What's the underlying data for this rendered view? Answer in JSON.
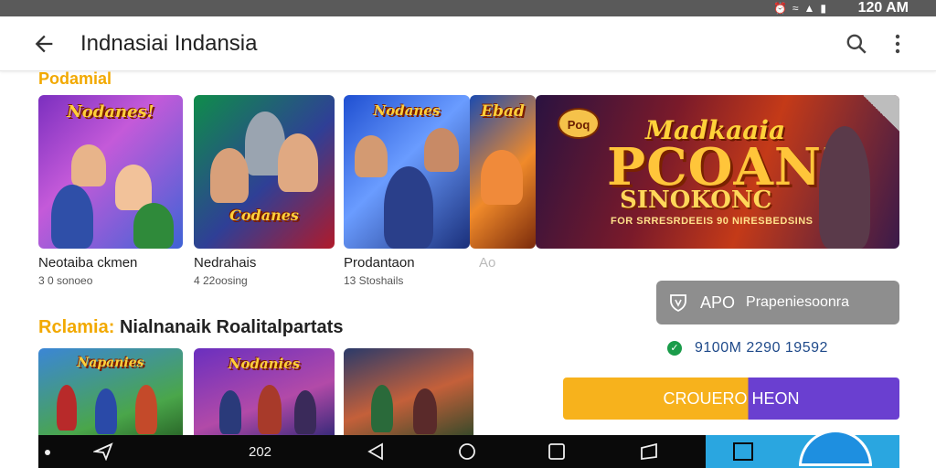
{
  "status_bar": {
    "time": "120 AM",
    "icons": [
      "alarm-icon",
      "wifi-icon",
      "signal-icon",
      "battery-icon"
    ]
  },
  "app_bar": {
    "title": "Indnasiai Indansia",
    "icons": [
      "back-arrow-icon",
      "search-icon",
      "more-vert-icon"
    ]
  },
  "section1": {
    "title": "Podamial"
  },
  "cards": [
    {
      "art_title": "Nodanes!",
      "name": "Neotaiba ckmen",
      "sub": "3 0 sonoeo"
    },
    {
      "art_title": "Codanes",
      "name": "Nedrahais",
      "sub": "4 22oosing"
    },
    {
      "art_title": "Nodanes",
      "name": "Prodantaon",
      "sub": "13 Stoshails"
    },
    {
      "art_title": "Ebad",
      "name": "Ao",
      "sub": ""
    }
  ],
  "banner": {
    "badge": "Poq",
    "line1": "Madkaaia",
    "line2": "PCOANL",
    "line3": "SINOKONC",
    "line4": "FOR SRRESRDEEIS 90 NIRESBEDSINS"
  },
  "promo_button": {
    "label": "APO",
    "sub_label": "Prapeniesoonra"
  },
  "verified_row": {
    "text": "9100M 2290 19592"
  },
  "cta_button": {
    "label": "CROUERO HEON"
  },
  "section2": {
    "accent": "Rclamia:",
    "title": "Nialnanaik Roalitalpartats"
  },
  "thumbnails": [
    {
      "art_title": "Napanies"
    },
    {
      "art_title": "Nodanies"
    },
    {
      "art_title": ""
    }
  ],
  "nav_bar": {
    "number": "202",
    "icons": [
      "dot-icon",
      "share-icon",
      "back-icon",
      "home-icon",
      "recents-icon",
      "tablet-icon",
      "square-icon",
      "cloud-icon"
    ]
  },
  "colors": {
    "accent_yellow": "#f2a900",
    "cta_orange": "#f7b21c",
    "cta_purple": "#6a3fd0",
    "verified_green": "#1a9c4a",
    "nav_highlight": "#2aa6e0"
  }
}
